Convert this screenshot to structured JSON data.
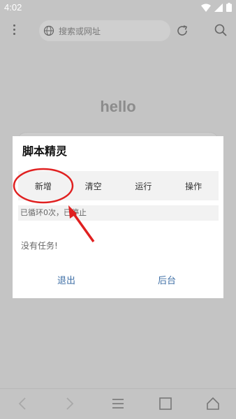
{
  "status_bar": {
    "time": "4:02"
  },
  "toolbar": {
    "search_placeholder": "搜索或网址"
  },
  "page": {
    "heading": "hello"
  },
  "dialog": {
    "title": "脚本精灵",
    "buttons": [
      {
        "label": "新增"
      },
      {
        "label": "清空"
      },
      {
        "label": "运行"
      },
      {
        "label": "操作"
      }
    ],
    "loop_status": "已循环0次，已停止",
    "task_message": "没有任务!",
    "exit_label": "退出",
    "background_label": "后台"
  },
  "colors": {
    "accent_link": "#3f6fa6",
    "annotation_red": "#e02020"
  }
}
